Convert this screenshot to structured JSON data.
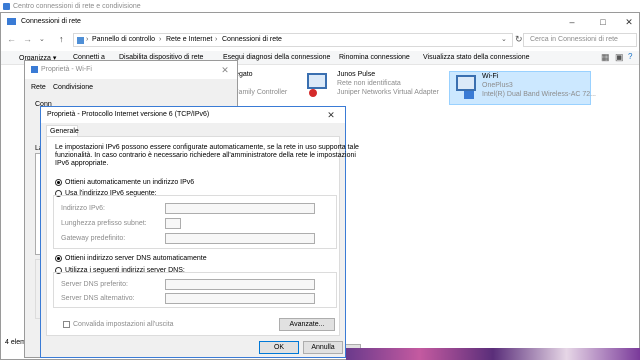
{
  "background_window": {
    "title": "Centro connessioni di rete e condivisione"
  },
  "explorer": {
    "title": "Connessioni di rete",
    "breadcrumb": [
      "Pannello di controllo",
      "Rete e Internet",
      "Connessioni di rete"
    ],
    "search_placeholder": "Cerca in Connessioni di rete",
    "toolbar": [
      "Organizza ▾",
      "Connetti a",
      "Disabilita dispositivo di rete",
      "Esegui diagnosi della connessione",
      "Rinomina connessione",
      "Visualizza stato della connessione"
    ],
    "status": "4 elementi",
    "items": [
      {
        "name": "Collegato",
        "line2": "",
        "line3": "BE Family Controller"
      },
      {
        "name": "Junos Pulse",
        "line2": "Rete non identificata",
        "line3": "Juniper Networks Virtual Adapter"
      },
      {
        "name": "Wi-Fi",
        "line2": "OnePlus3",
        "line3": "Intel(R) Dual Band Wireless-AC 72..."
      }
    ]
  },
  "wifi_props": {
    "title": "Proprietà - Wi-Fi",
    "tabs": [
      "Rete",
      "Condivisione"
    ],
    "left_labels": [
      "Conn",
      "La",
      "C"
    ]
  },
  "ipv6_dialog": {
    "title": "Proprietà - Protocollo Internet versione 6 (TCP/IPv6)",
    "tab": "Generale",
    "description": [
      "Le impostazioni IPv6 possono essere configurate automaticamente, se la rete in uso supporta tale",
      "funzionalità. In caso contrario è necessario richiedere all'amministratore della rete le impostazioni",
      "IPv6 appropriate."
    ],
    "ip_auto": "Ottieni automaticamente un indirizzo IPv6",
    "ip_manual": "Usa l'indirizzo IPv6 seguente:",
    "ip_address_label": "Indirizzo IPv6:",
    "prefix_label": "Lunghezza prefisso subnet:",
    "gateway_label": "Gateway predefinito:",
    "dns_auto": "Ottieni indirizzo server DNS automaticamente",
    "dns_manual": "Utilizza i seguenti indirizzi server DNS:",
    "dns_pref_label": "Server DNS preferito:",
    "dns_alt_label": "Server DNS alternativo:",
    "validate_label": "Convalida impostazioni all'uscita",
    "advanced_button": "Avanzate...",
    "ok_button": "OK",
    "cancel_button": "Annulla"
  },
  "wifi_footer": {
    "ok": "OK"
  },
  "colors": {
    "selected_item": "#cce8ff",
    "toolbar_bg": "#f5f6f7",
    "window_border": "#9a9a9a"
  }
}
